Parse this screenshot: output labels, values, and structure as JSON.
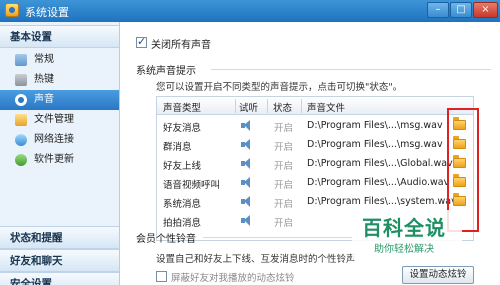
{
  "window": {
    "title": "系统设置",
    "minimize": "–",
    "maximize": "□",
    "close": "×"
  },
  "sidebar": {
    "section1": "基本设置",
    "items": [
      {
        "label": "常规",
        "icon": "settings-icon"
      },
      {
        "label": "热键",
        "icon": "keyboard-icon"
      },
      {
        "label": "声音",
        "icon": "sound-icon",
        "active": true
      },
      {
        "label": "文件管理",
        "icon": "folder-icon"
      },
      {
        "label": "网络连接",
        "icon": "network-icon"
      },
      {
        "label": "软件更新",
        "icon": "update-icon"
      }
    ],
    "section2": "状态和提醒",
    "section3": "好友和聊天",
    "section4": "安全设置"
  },
  "main": {
    "mute_all_label": "关闭所有声音",
    "mute_all_checked": true,
    "system_group_title": "系统声音提示",
    "system_desc": "您可以设置开启不同类型的声音提示，点击可切换\"状态\"。",
    "table": {
      "headers": [
        "声音类型",
        "试听",
        "状态",
        "声音文件"
      ],
      "rows": [
        {
          "type": "好友消息",
          "status": "开启",
          "file": "D:\\Program Files\\...\\msg.wav"
        },
        {
          "type": "群消息",
          "status": "开启",
          "file": "D:\\Program Files\\...\\msg.wav"
        },
        {
          "type": "好友上线",
          "status": "开启",
          "file": "D:\\Program Files\\...\\Global.wav"
        },
        {
          "type": "语音视频呼叫",
          "status": "开启",
          "file": "D:\\Program Files\\...\\Audio.wav"
        },
        {
          "type": "系统消息",
          "status": "开启",
          "file": "D:\\Program Files\\...\\system.wav"
        },
        {
          "type": "拍拍消息",
          "status": "开启",
          "file": ""
        }
      ]
    },
    "member_group_title": "会员个性铃音",
    "member_desc": "设置自己和好友上下线、互发消息时的个性铃声",
    "block_label": "屏蔽好友对我播放的动态炫铃",
    "block_checked": false,
    "dynamic_ring_button": "设置动态炫铃"
  },
  "watermark": {
    "main": "百科全说",
    "sub": "助你轻松解决"
  }
}
